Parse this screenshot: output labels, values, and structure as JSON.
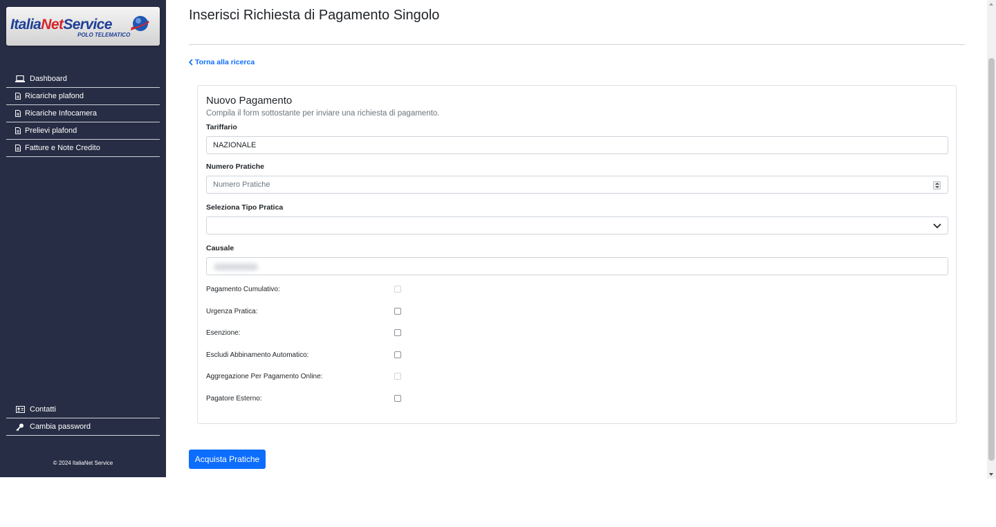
{
  "logo": {
    "brand_part1": "Italia",
    "brand_part2": "Net",
    "brand_part3": "Service",
    "subtitle": "POLO TELEMATICO"
  },
  "sidebar": {
    "items": [
      {
        "label": "Dashboard",
        "icon": "laptop-icon"
      },
      {
        "label": "Ricariche plafond",
        "icon": "document-icon"
      },
      {
        "label": "Ricariche Infocamera",
        "icon": "document-icon"
      },
      {
        "label": "Prelievi plafond",
        "icon": "document-icon"
      },
      {
        "label": "Fatture e Note Credito",
        "icon": "document-icon"
      }
    ],
    "bottom_items": [
      {
        "label": "Contatti",
        "icon": "contact-card-icon"
      },
      {
        "label": "Cambia password",
        "icon": "key-icon"
      }
    ],
    "copyright": "© 2024 ItaliaNet Service"
  },
  "header": {
    "title": "Inserisci Richiesta di Pagamento Singolo",
    "back_link": "Torna alla ricerca"
  },
  "form": {
    "title": "Nuovo Pagamento",
    "subtitle": "Compila il form sottostante per inviare una richiesta di pagamento.",
    "tariffario": {
      "label": "Tariffario",
      "value": "NAZIONALE"
    },
    "numero_pratiche": {
      "label": "Numero Pratiche",
      "placeholder": "Numero Pratiche",
      "value": ""
    },
    "tipo_pratica": {
      "label": "Seleziona Tipo Pratica",
      "selected": ""
    },
    "causale": {
      "label": "Causale",
      "value": ""
    },
    "checkboxes": [
      {
        "label": "Pagamento Cumulativo:",
        "checked": false,
        "disabled": true
      },
      {
        "label": "Urgenza Pratica:",
        "checked": false,
        "disabled": false
      },
      {
        "label": "Esenzione:",
        "checked": false,
        "disabled": false
      },
      {
        "label": "Escludi Abbinamento Automatico:",
        "checked": false,
        "disabled": false
      },
      {
        "label": "Aggregazione Per Pagamento Online:",
        "checked": false,
        "disabled": true
      },
      {
        "label": "Pagatore Esterno:",
        "checked": false,
        "disabled": false
      }
    ],
    "submit_label": "Acquista Pratiche"
  },
  "colors": {
    "sidebar_bg": "#272d44",
    "accent": "#0d6efd",
    "brand_blue": "#1f3f97",
    "brand_red": "#d3262b"
  }
}
